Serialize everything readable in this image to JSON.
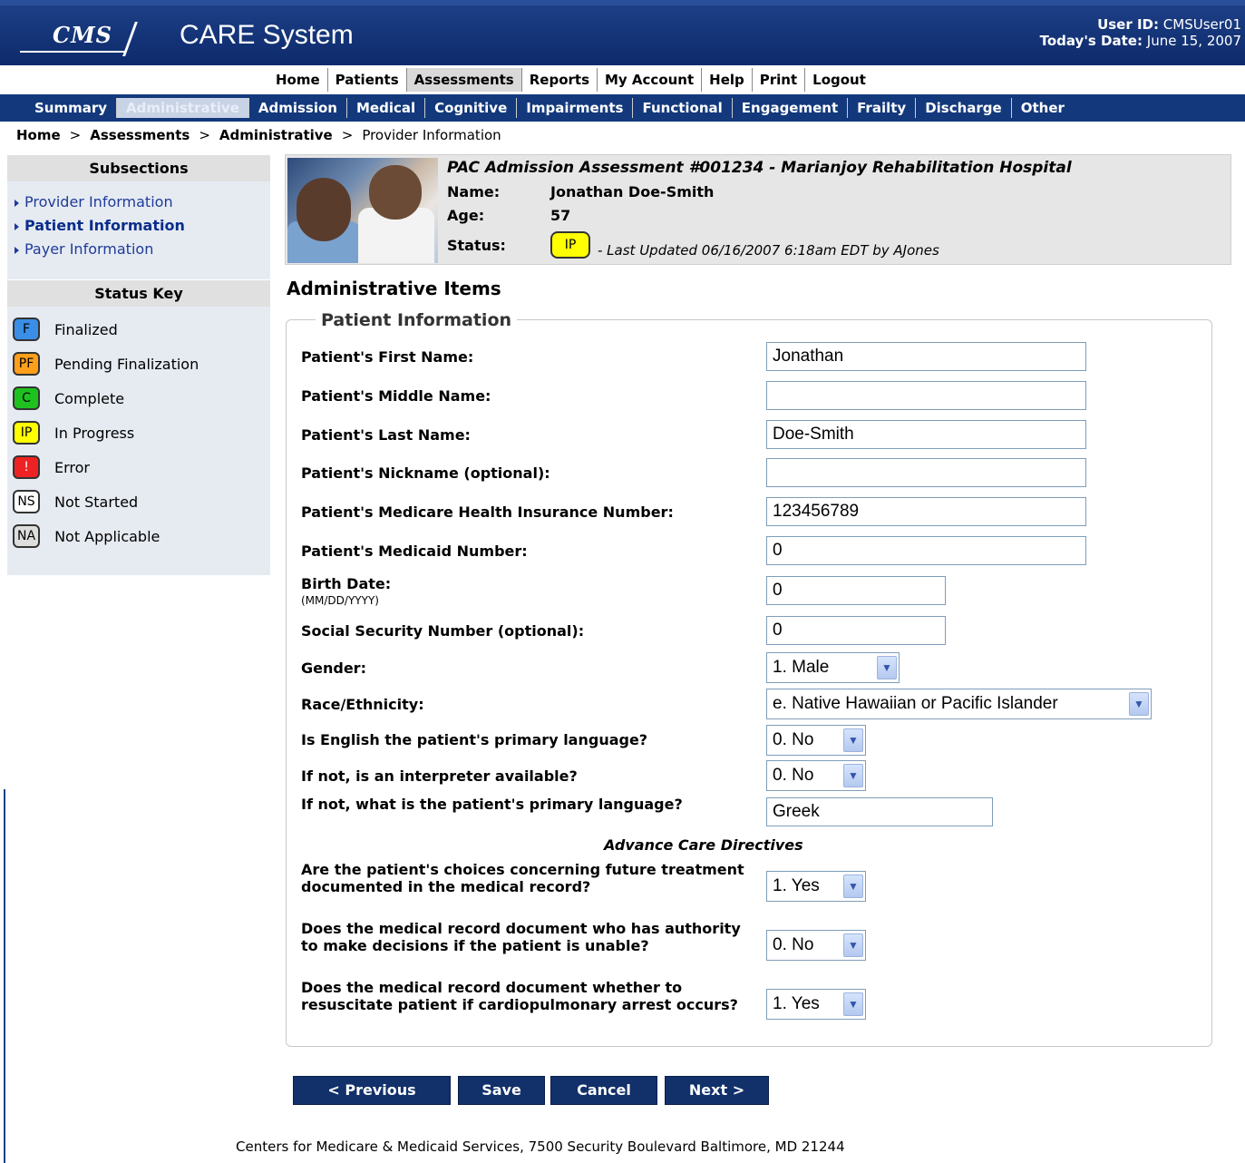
{
  "header": {
    "logo_text": "CMS",
    "app_title": "CARE System",
    "user_id_label": "User ID:",
    "user_id_value": "CMSUser01",
    "date_label": "Today's Date:",
    "date_value": "June 15, 2007"
  },
  "topnav": [
    "Home",
    "Patients",
    "Assessments",
    "Reports",
    "My Account",
    "Help",
    "Print",
    "Logout"
  ],
  "subnav": [
    "Summary",
    "Administrative",
    "Admission",
    "Medical",
    "Cognitive",
    "Impairments",
    "Functional",
    "Engagement",
    "Frailty",
    "Discharge",
    "Other"
  ],
  "breadcrumb": {
    "home": "Home",
    "assessments": "Assessments",
    "administrative": "Administrative",
    "current": "Provider Information",
    "sep": ">"
  },
  "sidebar": {
    "subsections_title": "Subsections",
    "subsections": [
      "Provider Information",
      "Patient Information",
      "Payer Information"
    ],
    "status_key_title": "Status Key",
    "status_key": [
      {
        "code": "F",
        "label": "Finalized",
        "color": "#3a8ee6"
      },
      {
        "code": "PF",
        "label": "Pending Finalization",
        "color": "#ff9f1a"
      },
      {
        "code": "C",
        "label": "Complete",
        "color": "#1ec21e"
      },
      {
        "code": "IP",
        "label": "In Progress",
        "color": "#ffff00"
      },
      {
        "code": "!",
        "label": "Error",
        "color": "#ee2222"
      },
      {
        "code": "NS",
        "label": "Not Started",
        "color": "#ffffff"
      },
      {
        "code": "NA",
        "label": "Not Applicable",
        "color": "#dddddd"
      }
    ]
  },
  "assessment": {
    "title": "PAC Admission Assessment #001234 - Marianjoy Rehabilitation Hospital",
    "name_label": "Name:",
    "name_value": "Jonathan Doe-Smith",
    "age_label": "Age:",
    "age_value": "57",
    "status_label": "Status:",
    "status_value": "IP",
    "last_updated": "- Last Updated 06/16/2007 6:18am EDT by AJones"
  },
  "section_title": "Administrative Items",
  "form": {
    "legend": "Patient Information",
    "first_name_label": "Patient's First Name:",
    "first_name_value": "Jonathan",
    "middle_name_label": "Patient's Middle Name:",
    "middle_name_value": "",
    "last_name_label": "Patient's Last Name:",
    "last_name_value": "Doe-Smith",
    "nickname_label": "Patient's Nickname (optional):",
    "nickname_value": "",
    "medicare_label": "Patient's Medicare Health Insurance Number:",
    "medicare_value": "123456789",
    "medicaid_label": "Patient's Medicaid Number:",
    "medicaid_value": "0",
    "birth_label": "Birth Date:",
    "birth_hint": "(MM/DD/YYYY)",
    "birth_value": "0",
    "ssn_label": "Social Security Number (optional):",
    "ssn_value": "0",
    "gender_label": "Gender:",
    "gender_value": "1. Male",
    "race_label": "Race/Ethnicity:",
    "race_value": "e. Native Hawaiian or Pacific Islander",
    "english_label": "Is English the patient's primary language?",
    "english_value": "0. No",
    "interpreter_label": "If not, is an interpreter available?",
    "interpreter_value": "0. No",
    "primary_lang_label": "If not, what is the patient's primary language?",
    "primary_lang_value": "Greek",
    "acd_heading": "Advance Care Directives",
    "choices_label": "Are the patient's choices concerning future treatment documented in the medical record?",
    "choices_value": "1. Yes",
    "authority_label": "Does the medical record document who has authority to make decisions if the patient is unable?",
    "authority_value": "0. No",
    "resuscitate_label": "Does the medical record document whether to resuscitate patient if cardiopulmonary arrest occurs?",
    "resuscitate_value": "1. Yes"
  },
  "buttons": {
    "previous": "< Previous",
    "save": "Save",
    "cancel": "Cancel",
    "next": "Next >"
  },
  "footer": "Centers for Medicare & Medicaid Services, 7500 Security Boulevard Baltimore, MD 21244"
}
